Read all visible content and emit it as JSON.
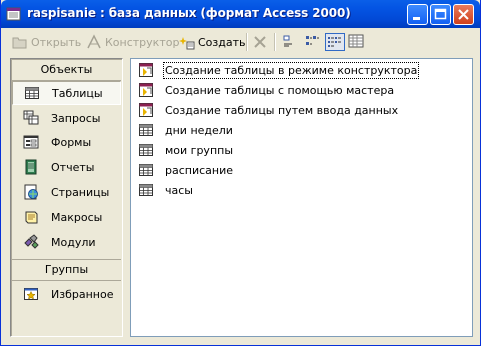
{
  "window": {
    "title": "raspisanie : база данных (формат Access 2000)"
  },
  "toolbar": {
    "open_label": "Открыть",
    "design_label": "Конструктор",
    "create_label": "Создать"
  },
  "sidebar": {
    "objects_header": "Объекты",
    "groups_header": "Группы",
    "items": [
      {
        "label": "Таблицы",
        "icon": "table-icon",
        "selected": true
      },
      {
        "label": "Запросы",
        "icon": "query-icon"
      },
      {
        "label": "Формы",
        "icon": "form-icon"
      },
      {
        "label": "Отчеты",
        "icon": "report-icon"
      },
      {
        "label": "Страницы",
        "icon": "page-icon"
      },
      {
        "label": "Макросы",
        "icon": "macro-icon"
      },
      {
        "label": "Модули",
        "icon": "module-icon"
      }
    ],
    "favorites_label": "Избранное"
  },
  "list": {
    "items": [
      {
        "label": "Создание таблицы в режиме конструктора",
        "icon": "create-shortcut-icon"
      },
      {
        "label": "Создание таблицы с помощью мастера",
        "icon": "create-shortcut-icon"
      },
      {
        "label": "Создание таблицы путем ввода данных",
        "icon": "create-shortcut-icon"
      },
      {
        "label": "дни недели",
        "icon": "table-icon"
      },
      {
        "label": "мои группы",
        "icon": "table-icon"
      },
      {
        "label": "расписание",
        "icon": "table-icon"
      },
      {
        "label": "часы",
        "icon": "table-icon"
      }
    ]
  },
  "colors": {
    "titlebar": "#0454e3",
    "window_bg": "#ece9d8",
    "selection_border": "#316ac5"
  }
}
